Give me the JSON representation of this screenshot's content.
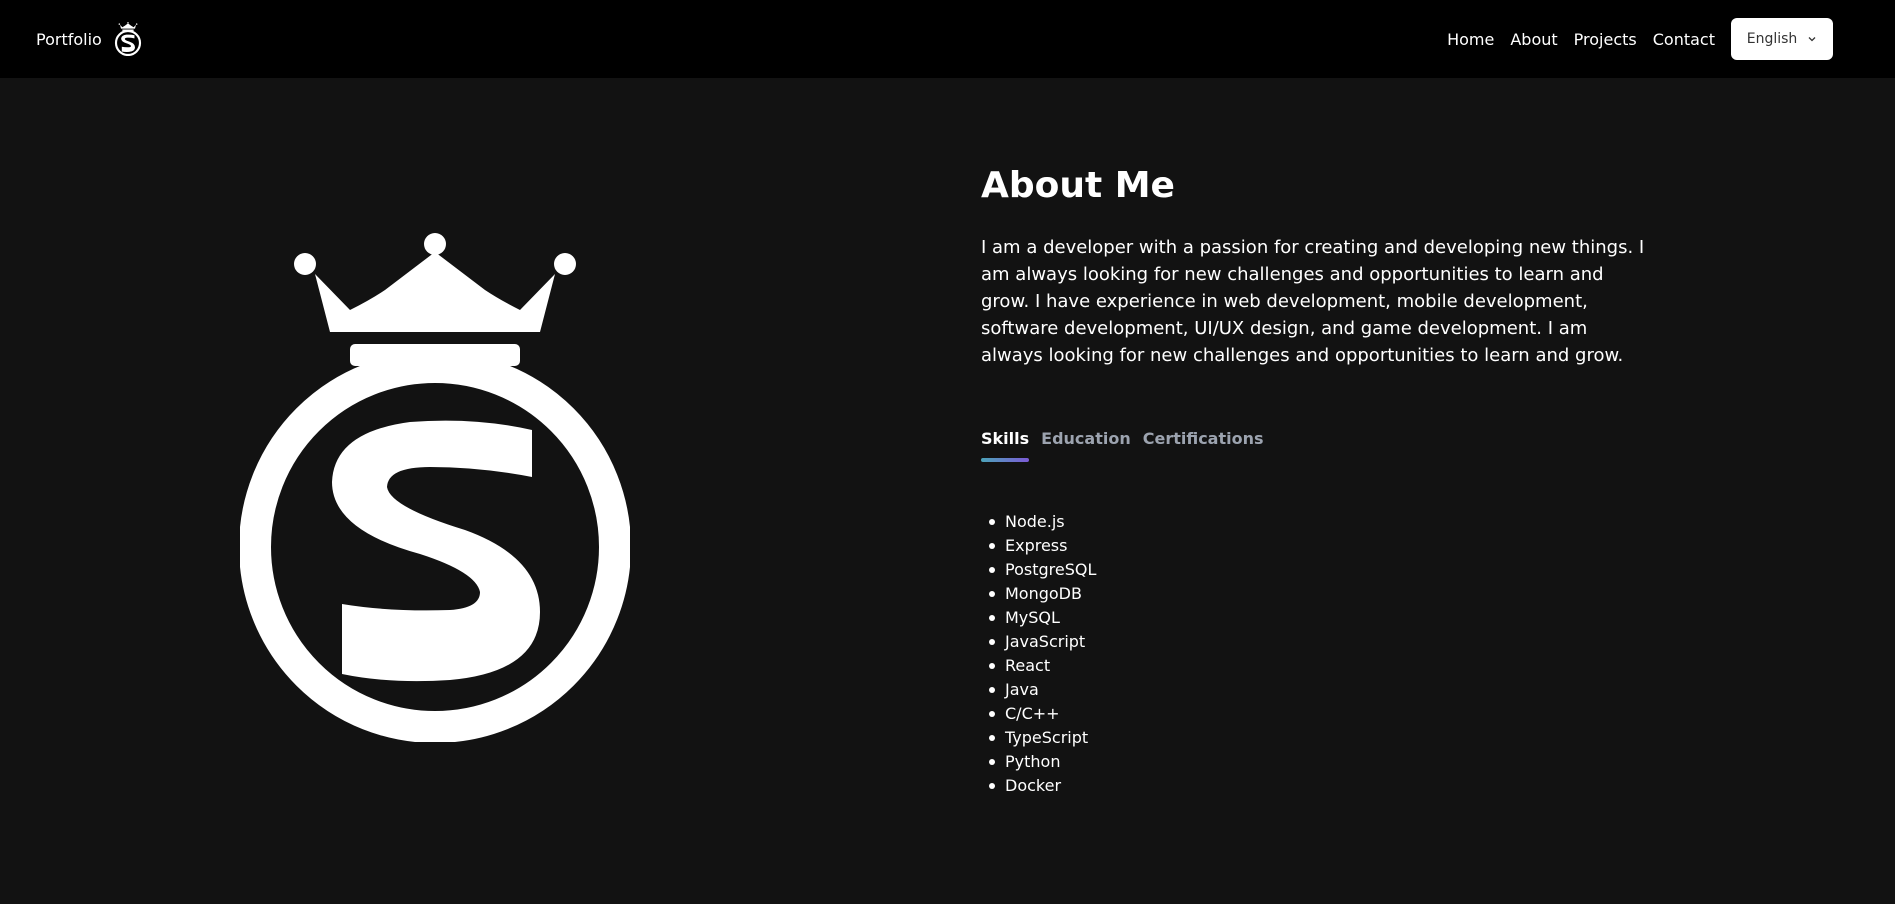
{
  "nav": {
    "brand": "Portfolio",
    "brand_icon": "crown-s-logo-icon",
    "links": [
      "Home",
      "About",
      "Projects",
      "Contact"
    ],
    "language": "English",
    "language_icon": "chevron-down-icon"
  },
  "hero": {
    "logo_icon": "crown-s-logo-icon"
  },
  "about": {
    "title": "About Me",
    "paragraph": "I am a developer with a passion for creating and developing new things. I am always looking for new challenges and opportunities to learn and grow. I have experience in web development, mobile development, software development, UI/UX design, and game development. I am always looking for new challenges and opportunities to learn and grow.",
    "tabs": [
      "Skills",
      "Education",
      "Certifications"
    ],
    "active_tab": "Skills",
    "skills": [
      "Node.js",
      "Express",
      "PostgreSQL",
      "MongoDB",
      "MySQL",
      "JavaScript",
      "React",
      "Java",
      "C/C++",
      "TypeScript",
      "Python",
      "Docker"
    ]
  },
  "colors": {
    "background": "#121212",
    "navbar": "#000000",
    "text": "#ffffff",
    "tab_inactive": "#9ca3af",
    "tab_underline_start": "#4ba3b8",
    "tab_underline_end": "#7c5bd6"
  }
}
